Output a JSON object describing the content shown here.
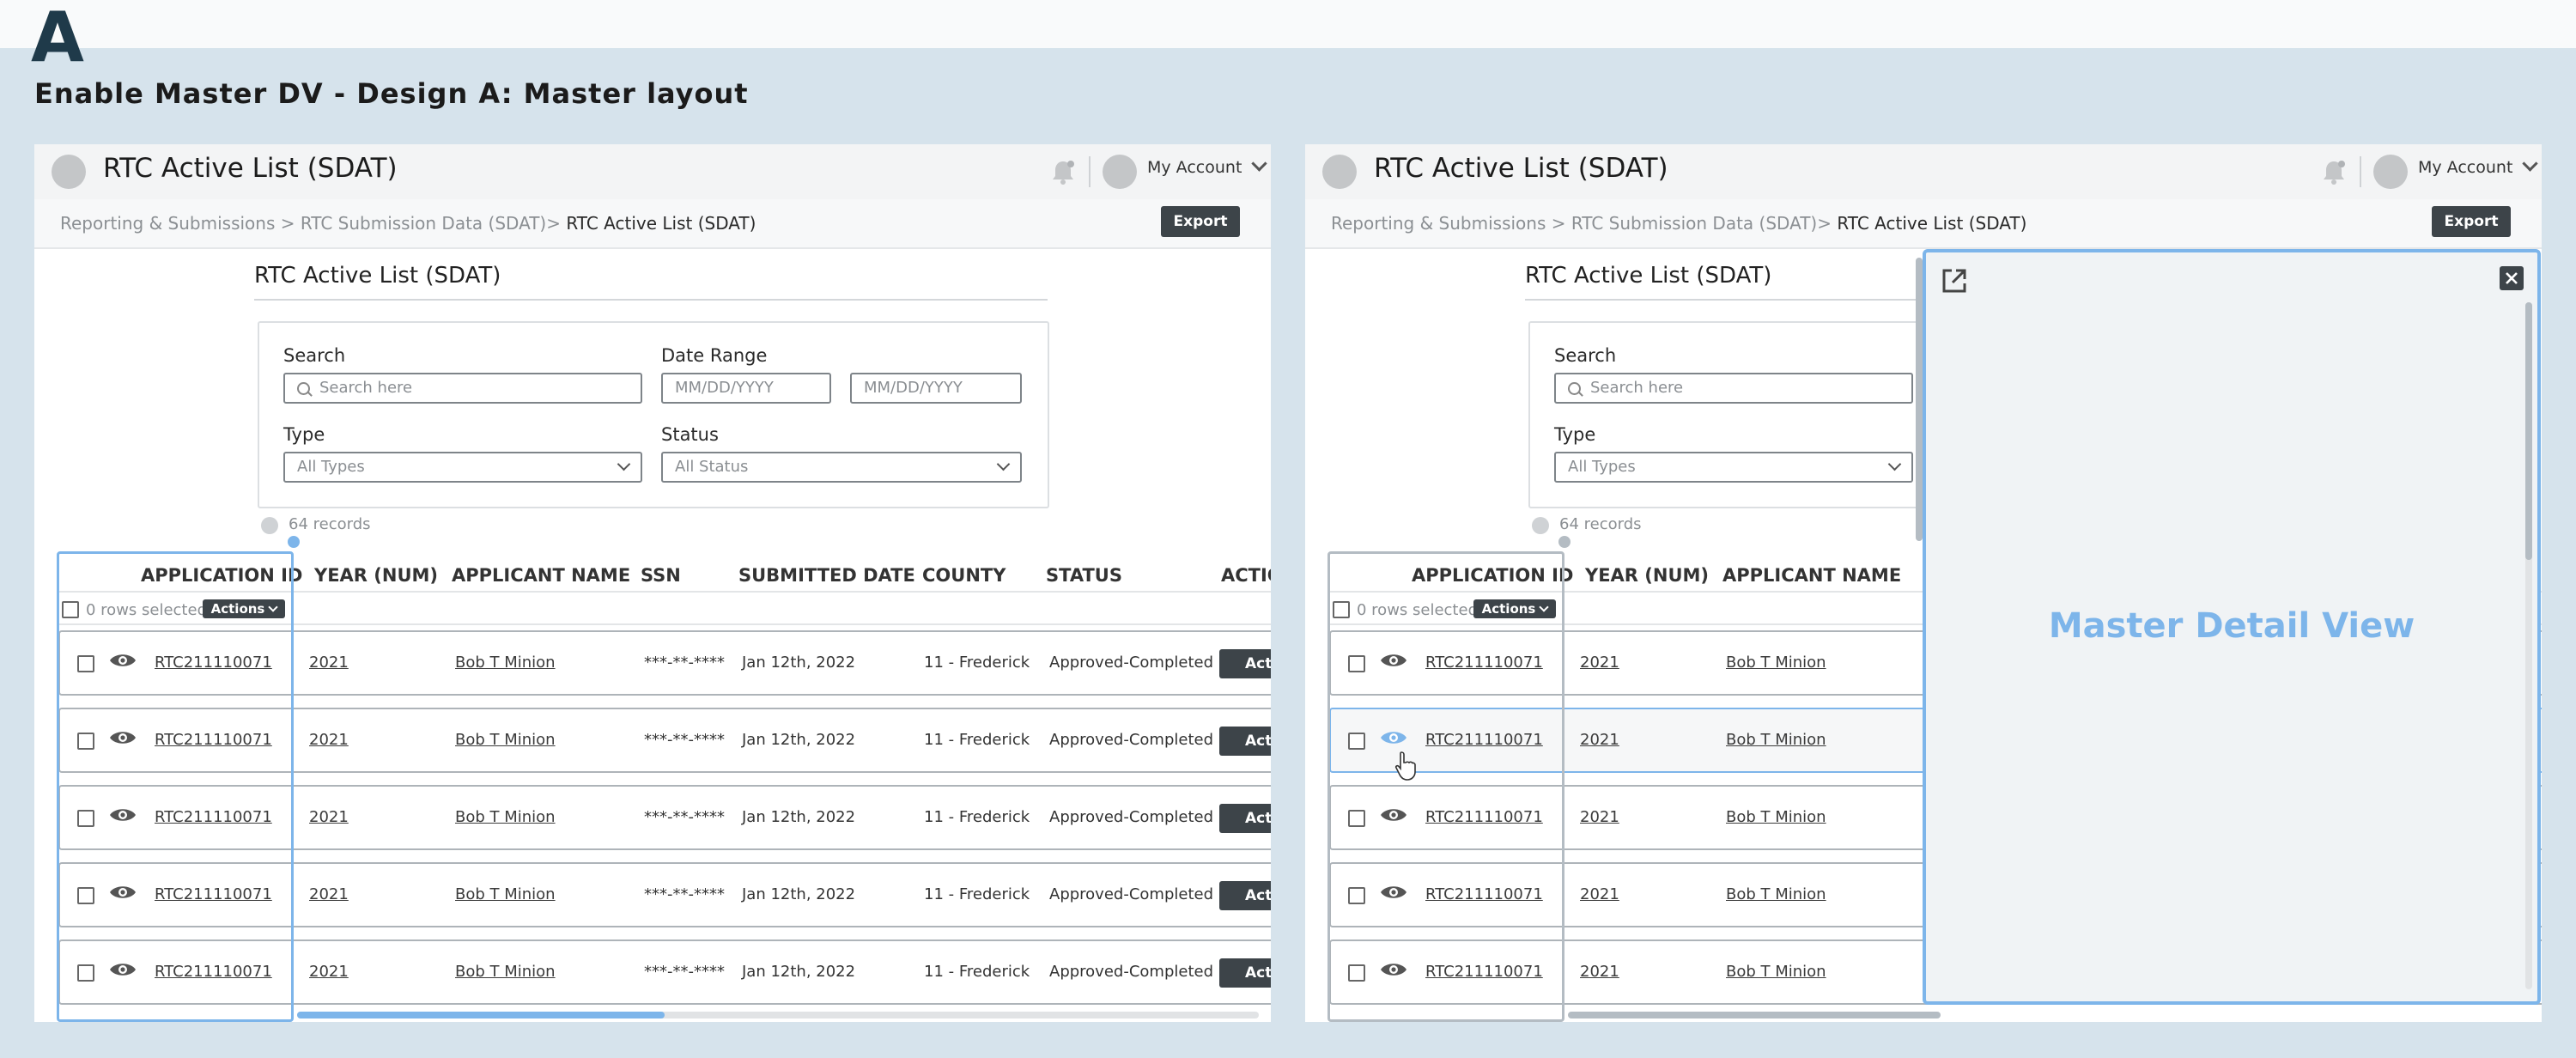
{
  "page": {
    "section_letter": "A",
    "heading": "Enable Master DV - Design A: Master layout"
  },
  "header": {
    "title": "RTC Active List (SDAT)",
    "account_label": "My Account"
  },
  "breadcrumb": {
    "part1": "Reporting & Submissions > RTC Submission Data (SDAT)> ",
    "current": "RTC Active List (SDAT)",
    "export_label": "Export"
  },
  "filters": {
    "list_title": "RTC Active List (SDAT)",
    "search_label": "Search",
    "search_placeholder": "Search here",
    "date_range_label": "Date Range",
    "date_from_placeholder": "MM/DD/YYYY",
    "date_to_placeholder": "MM/DD/YYYY",
    "type_label": "Type",
    "type_value": "All Types",
    "status_label": "Status",
    "status_value": "All Status"
  },
  "table": {
    "records": "64 records",
    "rows_selected": "0 rows selected",
    "actions_label": "Actions",
    "columns": {
      "application_id": "APPLICATION ID",
      "year": "YEAR (NUM)",
      "applicant": "APPLICANT NAME",
      "ssn": "SSN",
      "submitted": "SUBMITTED DATE",
      "county": "COUNTY",
      "status": "STATUS",
      "action": "ACTIO"
    },
    "row_action_label": "Acti",
    "rows": [
      {
        "app_id": "RTC211110071",
        "year": "2021",
        "applicant": "Bob T Minion",
        "ssn": "***-**-****",
        "date": "Jan 12th, 2022",
        "county": "11 - Frederick",
        "status": "Approved-Completed"
      },
      {
        "app_id": "RTC211110071",
        "year": "2021",
        "applicant": "Bob T Minion",
        "ssn": "***-**-****",
        "date": "Jan 12th, 2022",
        "county": "11 - Frederick",
        "status": "Approved-Completed"
      },
      {
        "app_id": "RTC211110071",
        "year": "2021",
        "applicant": "Bob T Minion",
        "ssn": "***-**-****",
        "date": "Jan 12th, 2022",
        "county": "11 - Frederick",
        "status": "Approved-Completed"
      },
      {
        "app_id": "RTC211110071",
        "year": "2021",
        "applicant": "Bob T Minion",
        "ssn": "***-**-****",
        "date": "Jan 12th, 2022",
        "county": "11 - Frederick",
        "status": "Approved-Completed"
      },
      {
        "app_id": "RTC211110071",
        "year": "2021",
        "applicant": "Bob T Minion",
        "ssn": "***-**-****",
        "date": "Jan 12th, 2022",
        "county": "11 - Frederick",
        "status": "Approved-Completed"
      }
    ]
  },
  "detail_panel": {
    "title": "Master Detail View"
  },
  "colors": {
    "accent": "#7db5ea",
    "dark_button": "#3d4449",
    "page_bg": "#d6e3ec"
  },
  "icons": [
    "bell-icon",
    "avatar",
    "chevron-down-icon",
    "search-icon",
    "eye-icon",
    "open-external-icon",
    "close-icon",
    "pointer-cursor-icon"
  ]
}
